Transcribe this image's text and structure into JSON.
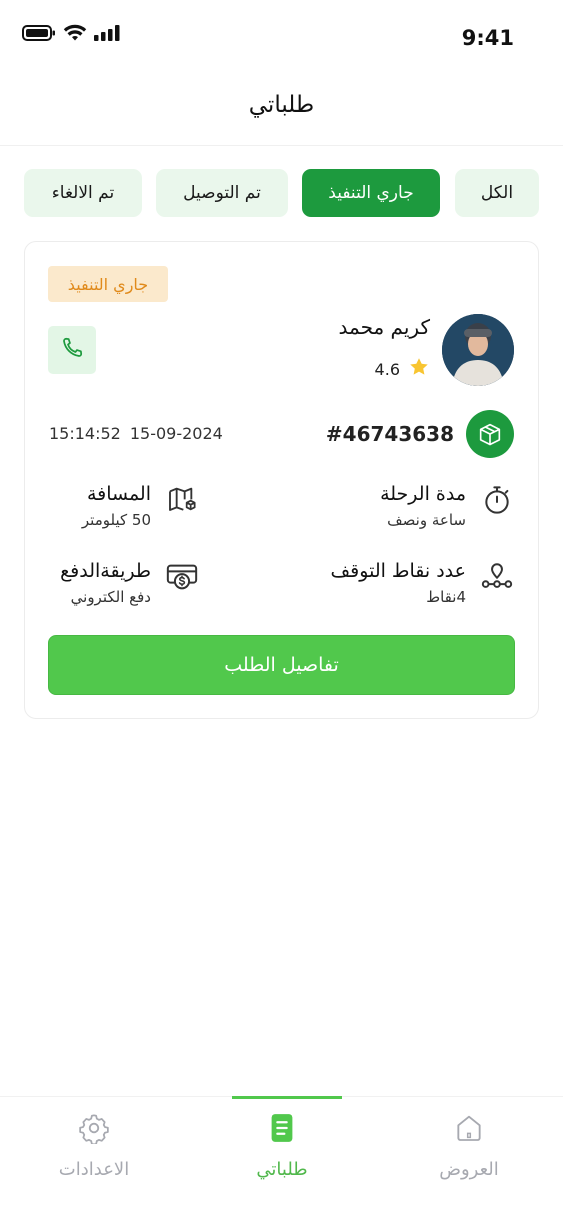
{
  "status_bar": {
    "time": "9:41"
  },
  "header": {
    "title": "طلباتي"
  },
  "tabs": [
    {
      "label": "الكل",
      "active": false
    },
    {
      "label": "جاري التنفيذ",
      "active": true
    },
    {
      "label": "تم التوصيل",
      "active": false
    },
    {
      "label": "تم الالغاء",
      "active": false
    }
  ],
  "order_card": {
    "status": "جاري التنفيذ",
    "driver": {
      "name": "كريم محمد",
      "rating": "4.6"
    },
    "order_number": "#46743638",
    "date": "15-09-2024",
    "time": "15:14:52",
    "info": {
      "duration": {
        "label": "مدة الرحلة",
        "value": "ساعة ونصف"
      },
      "distance": {
        "label": "المسافة",
        "value": "50 كيلومتر"
      },
      "stops": {
        "label": "عدد نقاط التوقف",
        "value": "4نقاط"
      },
      "payment": {
        "label": "طريقةالدفع",
        "value": "دفع الكتروني"
      }
    },
    "details_button": "تفاصيل الطلب"
  },
  "bottom_nav": [
    {
      "label": "العروض",
      "icon": "home-icon",
      "active": false
    },
    {
      "label": "طلباتي",
      "icon": "document-icon",
      "active": true
    },
    {
      "label": "الاعدادات",
      "icon": "gear-icon",
      "active": false
    }
  ],
  "colors": {
    "primary": "#1d9a3e",
    "button": "#51c84c",
    "badge_bg": "#fbe9cc",
    "badge_text": "#e08a1b",
    "tab_bg": "#eaf7ec"
  }
}
